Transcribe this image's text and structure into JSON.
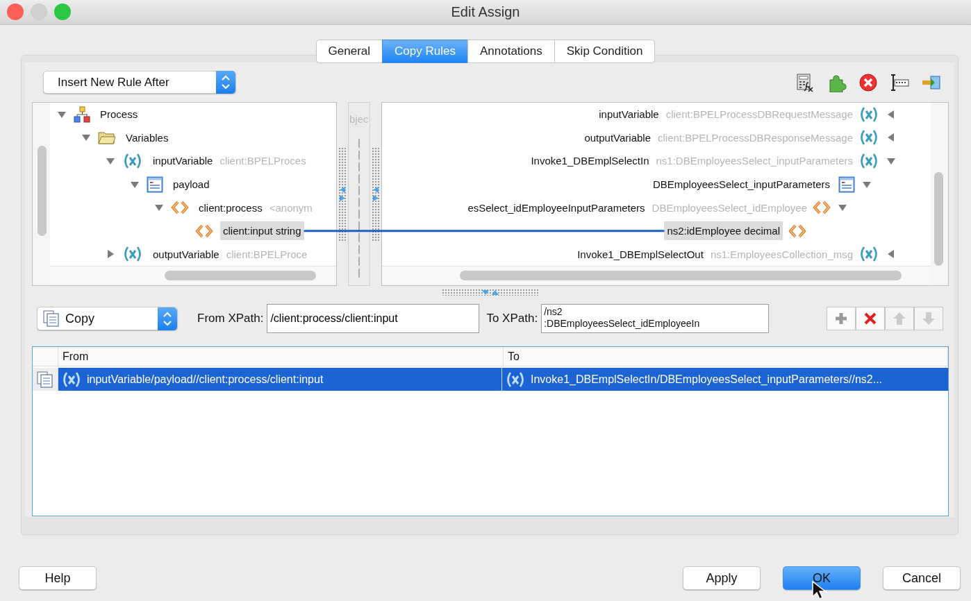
{
  "window": {
    "title": "Edit Assign"
  },
  "tabs": [
    {
      "label": "General",
      "selected": false
    },
    {
      "label": "Copy Rules",
      "selected": true
    },
    {
      "label": "Annotations",
      "selected": false
    },
    {
      "label": "Skip Condition",
      "selected": false
    }
  ],
  "rule_position": {
    "value": "Insert New Rule After"
  },
  "source_tree": [
    {
      "label": "Process",
      "kind": "process",
      "expanded": true,
      "mapped": false,
      "children": [
        {
          "label": "Variables",
          "kind": "folder",
          "expanded": true,
          "mapped": false,
          "children": [
            {
              "label": "inputVariable",
              "type": "client:BPELProces",
              "kind": "variable",
              "expanded": true,
              "mapped": false,
              "children": [
                {
                  "label": "payload",
                  "kind": "part",
                  "expanded": true,
                  "mapped": false,
                  "children": [
                    {
                      "label": "client:process",
                      "type": "<anonym",
                      "kind": "element",
                      "expanded": true,
                      "mapped": false,
                      "children": [
                        {
                          "label": "client:input string",
                          "kind": "element",
                          "mapped": true
                        }
                      ]
                    }
                  ]
                }
              ]
            },
            {
              "label": "outputVariable",
              "type": "client:BPELProce",
              "kind": "variable",
              "expanded": false,
              "mapped": false
            }
          ]
        }
      ]
    }
  ],
  "middle_column": {
    "label": "bjec"
  },
  "target_tree": [
    {
      "label": "inputVariable",
      "type": "client:BPELProcessDBRequestMessage",
      "kind": "variable",
      "expanded": false,
      "mapped": false
    },
    {
      "label": "outputVariable",
      "type": "client:BPELProcessDBResponseMessage",
      "kind": "variable",
      "expanded": false,
      "mapped": false
    },
    {
      "label": "Invoke1_DBEmplSelectIn",
      "type": "ns1:DBEmployeesSelect_inputParameters",
      "kind": "variable",
      "expanded": true,
      "mapped": false,
      "children": [
        {
          "label": "DBEmployeesSelect_inputParameters",
          "kind": "part",
          "expanded": true,
          "mapped": false,
          "children": [
            {
              "label": "esSelect_idEmployeeInputParameters",
              "type": "DBEmployeesSelect_idEmployee",
              "kind": "element",
              "expanded": true,
              "mapped": false,
              "children": [
                {
                  "label": "ns2:idEmployee decimal",
                  "kind": "element",
                  "mapped": true
                }
              ]
            }
          ]
        }
      ]
    },
    {
      "label": "Invoke1_DBEmplSelectOut",
      "type": "ns1:EmployeesCollection_msg",
      "kind": "variable",
      "expanded": false,
      "mapped": false
    }
  ],
  "operation": {
    "value": "Copy"
  },
  "from_xpath": {
    "label": "From XPath:",
    "value": "/client:process/client:input"
  },
  "to_xpath": {
    "label": "To XPath:",
    "value_lines": [
      "/ns2",
      ":DBEmployeesSelect_idEmployeeIn"
    ]
  },
  "rule_buttons": [
    {
      "kind": "add",
      "disabled": false
    },
    {
      "kind": "delete",
      "disabled": false
    },
    {
      "kind": "up",
      "disabled": true
    },
    {
      "kind": "down",
      "disabled": true
    }
  ],
  "rules_table": {
    "columns": [
      "From",
      "To"
    ],
    "rows": [
      {
        "from": "inputVariable/payload//client:process/client:input",
        "to": "Invoke1_DBEmplSelectIn/DBEmployeesSelect_inputParameters//ns2...",
        "selected": true
      }
    ]
  },
  "help_button": {
    "label": "Help"
  },
  "buttons": [
    {
      "label": "Apply",
      "default": false
    },
    {
      "label": "OK",
      "default": true
    },
    {
      "label": "Cancel",
      "default": false
    }
  ]
}
